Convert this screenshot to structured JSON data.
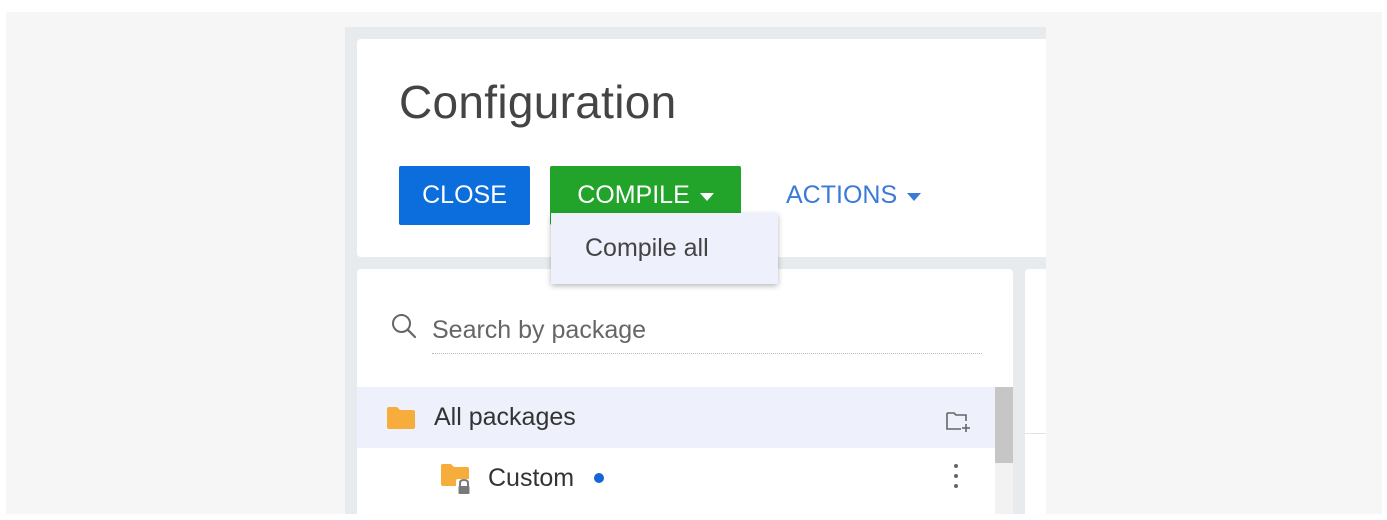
{
  "page": {
    "title": "Configuration"
  },
  "toolbar": {
    "close_label": "CLOSE",
    "compile_label": "COMPILE",
    "actions_label": "ACTIONS"
  },
  "compile_menu": {
    "items": [
      {
        "label": "Compile all"
      }
    ]
  },
  "search": {
    "placeholder": "Search by package",
    "value": ""
  },
  "packages": {
    "items": [
      {
        "label": "All packages",
        "icon": "folder-icon",
        "selected": true
      },
      {
        "label": "Custom",
        "icon": "locked-folder-icon",
        "indicator": "modified-dot"
      }
    ]
  },
  "colors": {
    "close_button": "#0c6edc",
    "compile_button": "#22a42a",
    "actions_link": "#3b7ad8",
    "folder": "#f6ad3c",
    "selected_row": "#eef1fb",
    "indicator_dot": "#1565d8"
  }
}
